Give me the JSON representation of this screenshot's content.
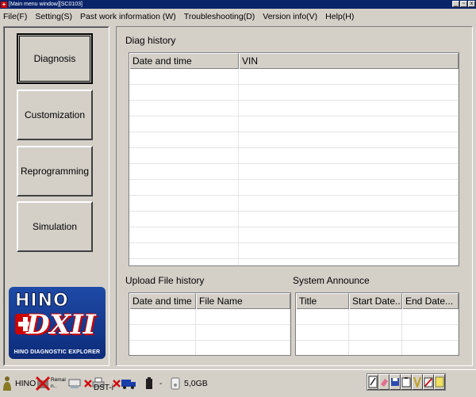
{
  "window": {
    "title": "[Main menu window][SC0103]",
    "buttons": [
      "_",
      "▫",
      "x"
    ]
  },
  "menu": [
    "File(F)",
    "Setting(S)",
    "Past work information (W)",
    "Troubleshooting(D)",
    "Version info(V)",
    "Help(H)"
  ],
  "sidebar": {
    "buttons": [
      {
        "label": "Diagnosis",
        "active": true
      },
      {
        "label": "Customization",
        "active": false
      },
      {
        "label": "Reprogramming",
        "active": false
      },
      {
        "label": "Simulation",
        "active": false
      }
    ],
    "logo": {
      "brand": "HINO",
      "product": "DXII",
      "tagline": "HINO DIAGNOSTIC EXPLORER"
    }
  },
  "diag_history": {
    "title": "Diag history",
    "columns": [
      "Date and time",
      "VIN"
    ],
    "rows": []
  },
  "upload_history": {
    "title": "Upload File history",
    "columns": [
      "Date and time",
      "File Name"
    ],
    "rows": []
  },
  "system_announce": {
    "title": "System Announce",
    "columns": [
      "Title",
      "Start Date...",
      "End Date..."
    ],
    "rows": []
  },
  "statusbar": {
    "brand": "HINO",
    "remain_label": "Remai n..",
    "device": "DST-i",
    "separator": "-",
    "disk": "5,0GB"
  },
  "colors": {
    "face": "#d4d0c8",
    "titlebar": "#0a246a",
    "logo_blue": "#1e4aa6",
    "logo_red": "#cc0000"
  }
}
